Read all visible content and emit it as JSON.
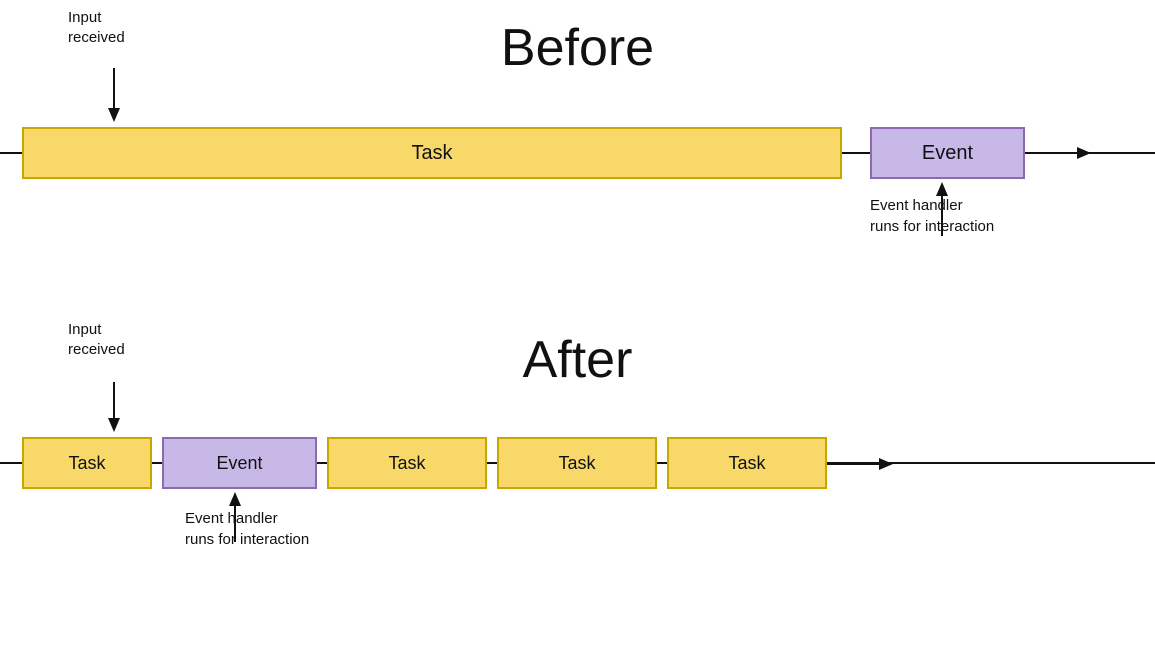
{
  "before": {
    "title": "Before",
    "input_received_label": "Input\nreceived",
    "task_label": "Task",
    "event_label": "Event",
    "event_handler_label": "Event handler\nruns for interaction"
  },
  "after": {
    "title": "After",
    "input_received_label": "Input\nreceived",
    "task_label_1": "Task",
    "event_label": "Event",
    "task_label_2": "Task",
    "task_label_3": "Task",
    "task_label_4": "Task",
    "event_handler_label": "Event handler\nruns for interaction"
  },
  "colors": {
    "task_fill": "#f9d86a",
    "task_border": "#c8a800",
    "event_fill": "#c8b8e8",
    "event_border": "#8b6ab0",
    "text": "#111111",
    "line": "#111111"
  }
}
